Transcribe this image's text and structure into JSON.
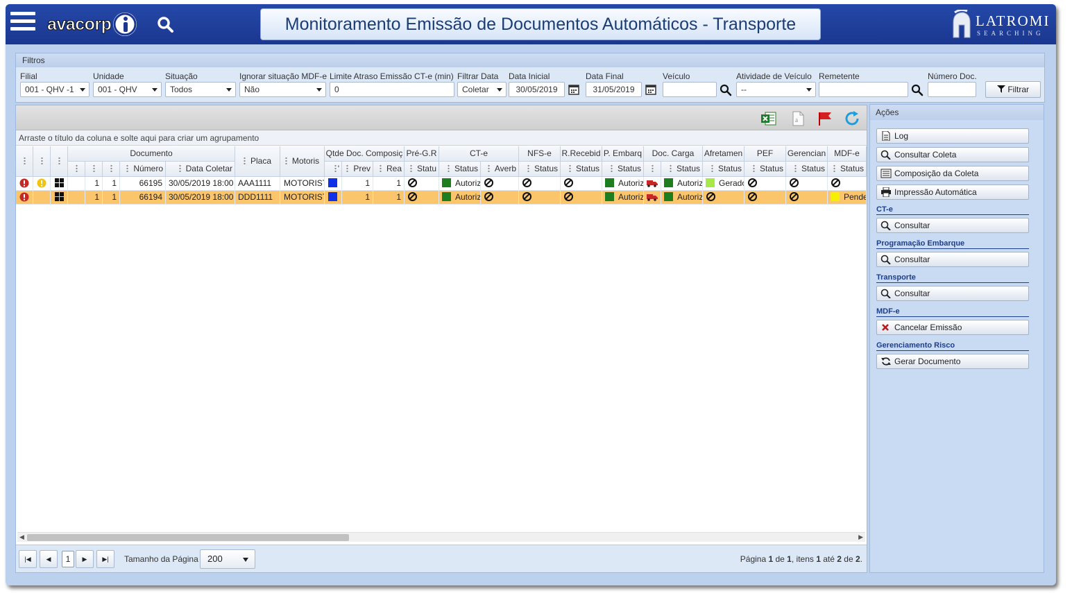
{
  "header": {
    "logo_text": "avacorp",
    "title": "Monitoramento Emissão de Documentos Automáticos - Transporte",
    "brand_name": "LATROMI",
    "brand_sub": "SEARCHING"
  },
  "filters": {
    "title": "Filtros",
    "filial": {
      "label": "Filial",
      "value": "001 - QHV -1"
    },
    "unidade": {
      "label": "Unidade",
      "value": "001 - QHV"
    },
    "situacao": {
      "label": "Situação",
      "value": "Todos"
    },
    "ignorar_mdfe": {
      "label": "Ignorar situação MDF-e",
      "value": "Não"
    },
    "limite_atraso": {
      "label": "Limite Atraso Emissão CT-e (min)",
      "value": "0"
    },
    "filtrar_data": {
      "label": "Filtrar Data",
      "value": "Coletar"
    },
    "data_inicial": {
      "label": "Data Inicial",
      "value": "30/05/2019"
    },
    "data_final": {
      "label": "Data Final",
      "value": "31/05/2019"
    },
    "veiculo": {
      "label": "Veículo",
      "value": ""
    },
    "atividade_veiculo": {
      "label": "Atividade de Veículo",
      "value": "--"
    },
    "remetente": {
      "label": "Remetente",
      "value": ""
    },
    "numero_doc": {
      "label": "Número Doc.",
      "value": ""
    },
    "filtrar_button": "Filtrar"
  },
  "grid": {
    "group_hint": "Arraste o título da coluna e solte aqui para criar um agrupamento",
    "group_headers": {
      "documento": "Documento",
      "placa": "Placa",
      "motorista": "Motoris",
      "qtde_doc": "Qtde Doc. Composiç",
      "pre_gr": "Pré-G.R",
      "cte": "CT-e",
      "nfse": "NFS-e",
      "r_recebido": "R.Recebid",
      "p_embarque": "P. Embarq",
      "doc_carga": "Doc. Carga",
      "afretamento": "Afretamen",
      "pef": "PEF",
      "gerenciamento": "Gerencian",
      "mdfe": "MDF-e"
    },
    "sub_headers": {
      "numero": "Número",
      "data_coletar": "Data Coletar",
      "prev": "Prev",
      "real": "Rea",
      "status_short": "Statu",
      "status": "Status",
      "averb": "Averb"
    },
    "rows": [
      {
        "c1": "1",
        "c2": "1",
        "numero": "66195",
        "data_coletar": "30/05/2019 18:00",
        "placa": "AAA1111",
        "motorista": "MOTORISTA",
        "prev": "1",
        "real": "1",
        "cte_status": "Autorizado",
        "p_embarque_status": "Autorizado",
        "doc_carga_status": "Autorizado",
        "afretamento_status": "Gerado",
        "mdfe_status": "",
        "selected": false
      },
      {
        "c1": "1",
        "c2": "1",
        "numero": "66194",
        "data_coletar": "30/05/2019 18:00",
        "placa": "DDD1111",
        "motorista": "MOTORISTA",
        "prev": "1",
        "real": "1",
        "cte_status": "Autorizado",
        "p_embarque_status": "Autorizado",
        "doc_carga_status": "Autorizado",
        "afretamento_status": "",
        "mdfe_status": "Pendente",
        "selected": true
      }
    ],
    "colors": {
      "blue": "#1030e8",
      "green": "#1e7d1e",
      "lime": "#a7e84a",
      "yellow": "#f4f000",
      "red": "#cc2222",
      "selected_row": "#fbc56c"
    }
  },
  "pager": {
    "current_page": "1",
    "page_size_label": "Tamanho da Página",
    "page_size": "200",
    "info_prefix": "Página ",
    "info_page": "1",
    "info_of": " de ",
    "info_pages": "1",
    "info_items": ", itens ",
    "info_from": "1",
    "info_to_word": " até ",
    "info_to": "2",
    "info_total_word": " de ",
    "info_total": "2",
    "info_end": "."
  },
  "actions": {
    "title": "Ações",
    "log": "Log",
    "consultar_coleta": "Consultar Coleta",
    "composicao_coleta": "Composição da Coleta",
    "impressao_automatica": "Impressão Automática",
    "sections": {
      "cte": "CT-e",
      "programacao_embarque": "Programação Embarque",
      "transporte": "Transporte",
      "mdfe": "MDF-e",
      "gerenciamento_risco": "Gerenciamento Risco"
    },
    "consultar": "Consultar",
    "cancelar_emissao": "Cancelar Emissão",
    "gerar_documento": "Gerar Documento"
  }
}
